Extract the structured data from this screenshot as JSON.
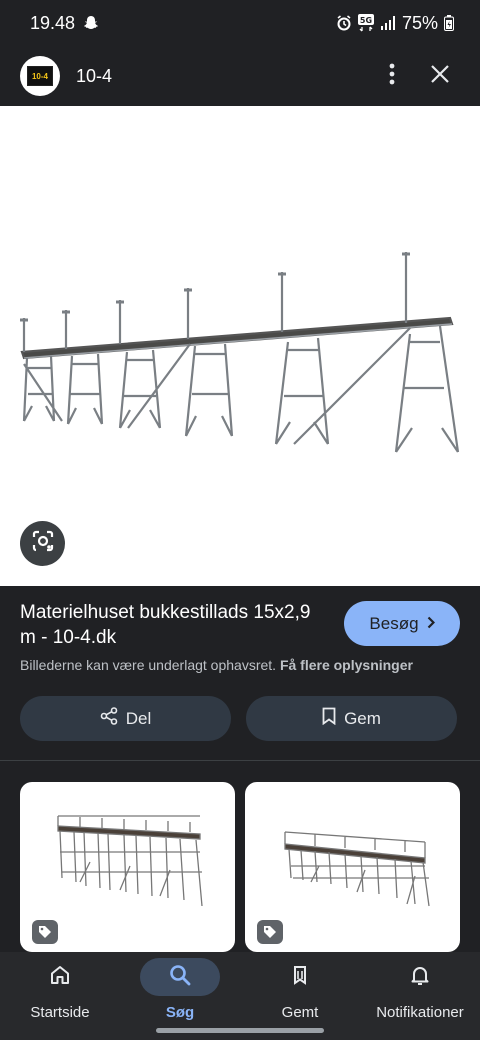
{
  "status_bar": {
    "time": "19.48",
    "network": "5G",
    "battery": "75%"
  },
  "header": {
    "site_name": "10-4",
    "logo_text": "10-4"
  },
  "result": {
    "title": "Materielhuset bukkestillads 15x2,9 m - 10-4.dk",
    "visit_label": "Besøg",
    "copyright_text": "Billederne kan være underlagt ophavsret.",
    "more_info_link": "Få flere oplysninger",
    "share_label": "Del",
    "save_label": "Gem"
  },
  "nav": {
    "items": [
      {
        "label": "Startside",
        "icon": "home-icon"
      },
      {
        "label": "Søg",
        "icon": "search-icon"
      },
      {
        "label": "Gemt",
        "icon": "bookmarks-icon"
      },
      {
        "label": "Notifikationer",
        "icon": "bell-icon"
      }
    ],
    "active_index": 1
  },
  "colors": {
    "accent": "#8ab4f8",
    "background": "#202124",
    "pill": "#303944"
  }
}
